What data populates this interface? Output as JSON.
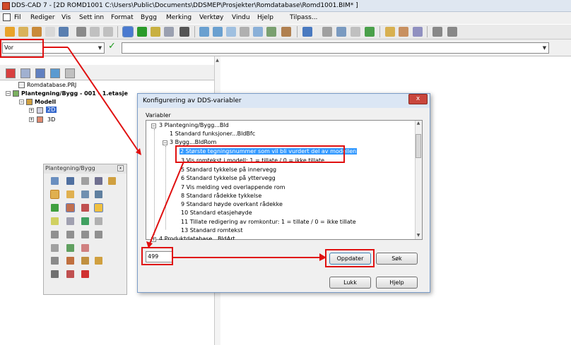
{
  "window": {
    "title": "DDS-CAD 7 - [2D  ROMD1001  C:\\Users\\Public\\Documents\\DDSMEP\\Prosjekter\\Romdatabase\\Romd1001.BIM* ]"
  },
  "menu": {
    "items": [
      "Fil",
      "Rediger",
      "Vis",
      "Sett inn",
      "Format",
      "Bygg",
      "Merking",
      "Verktøy",
      "Vindu",
      "Hjelp",
      "Tilpass..."
    ]
  },
  "combobar": {
    "layer_value": "Vor",
    "apply_icon": "checkmark-icon"
  },
  "tree": {
    "project": "Romdatabase.PRJ",
    "drawing": "Plantegning/Bygg - 001 - 1.etasje",
    "model": "Modell",
    "view2d": "2D",
    "view3d": "3D"
  },
  "palette": {
    "title": "Plantegning/Bygg",
    "close": "x"
  },
  "dialog": {
    "title": "Konfigurering av DDS-variabler",
    "close": "x",
    "variables_label": "Variabler",
    "rows": [
      "3  Plantegning/Bygg...Bld",
      "1  Standard funksjoner...BldBfc",
      "3  Bygg...BldRom",
      "2  Største tegningsnummer som vil bli vurdert del av modellen",
      "3  Vis romtekst i modell: 1 = tillate / 0 = ikke tillate",
      "5  Standard tykkelse på innervegg",
      "6  Standard tykkelse på yttervegg",
      "7  Vis melding ved overlappende rom",
      "8  Standard rådekke tykkelse",
      "9  Standard høyde overkant rådekke",
      "10  Standard etasjehøyde",
      "11  Tillate redigering av romkontur: 1 = tillate / 0 = ikke tillate",
      "13  Standard romtekst",
      "4  Produktdatabase...BldArt"
    ],
    "value": "499",
    "buttons": {
      "update": "Oppdater",
      "search": "Søk",
      "close": "Lukk",
      "help": "Hjelp"
    }
  },
  "colors": {
    "highlight": "#3399ff",
    "annotation": "#e01010"
  }
}
